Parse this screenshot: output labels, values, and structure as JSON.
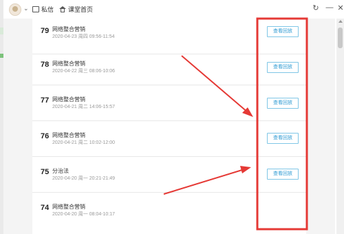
{
  "toolbar": {
    "messages_label": "私信",
    "classroom_home_label": "课堂首页"
  },
  "replay_label": "查看回放",
  "lessons": [
    {
      "num": "79",
      "title": "网络整合营销",
      "meta": "2020-04-23 周四 09:56-11:54",
      "has_replay": true
    },
    {
      "num": "78",
      "title": "网络整合营销",
      "meta": "2020-04-22 周三 08:06-10:06",
      "has_replay": true
    },
    {
      "num": "77",
      "title": "网络整合营销",
      "meta": "2020-04-21 周二 14:06-15:57",
      "has_replay": true
    },
    {
      "num": "76",
      "title": "网络整合营销",
      "meta": "2020-04-21 周二 10:02-12:00",
      "has_replay": true
    },
    {
      "num": "75",
      "title": "分治法",
      "meta": "2020-04-20 周一 20:21-21:49",
      "has_replay": true
    },
    {
      "num": "74",
      "title": "网络整合营销",
      "meta": "2020-04-20 周一 08:04-10:17",
      "has_replay": false
    }
  ],
  "colors": {
    "annotation": "#e53935",
    "replay_border": "#7fc6e6",
    "replay_text": "#2f9bd3"
  }
}
